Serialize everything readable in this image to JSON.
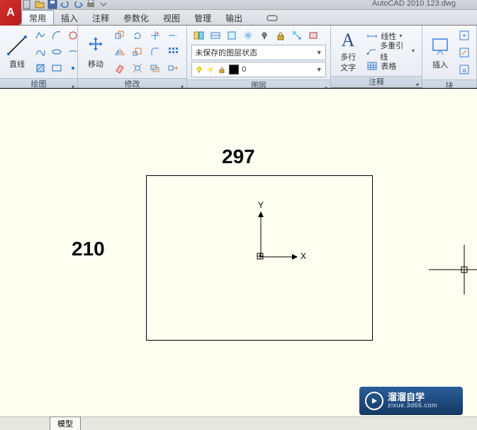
{
  "app": {
    "titlebar": "AutoCAD 2010    123.dwg",
    "logo_letter": "A"
  },
  "menu": {
    "tabs": [
      "常用",
      "插入",
      "注释",
      "参数化",
      "视图",
      "管理",
      "输出"
    ],
    "active_index": 0
  },
  "ribbon": {
    "draw": {
      "title": "绘图",
      "line_label": "直线"
    },
    "modify": {
      "title": "修改",
      "move_label": "移动"
    },
    "layers": {
      "title": "图层",
      "state_combo": "未保存的图层状态",
      "current_layer": "0"
    },
    "annotation": {
      "title": "注释",
      "mtext_label_l1": "多行",
      "mtext_label_l2": "文字",
      "linetype_label": "线性",
      "mleader_label": "多重引线",
      "table_label": "表格"
    },
    "block": {
      "title": "块",
      "insert_label": "插入"
    }
  },
  "drawing": {
    "width_label": "297",
    "height_label": "210",
    "y_axis": "Y",
    "x_axis": "X"
  },
  "watermark": {
    "brand": "溜溜自学",
    "url": "zixue.3d66.com"
  },
  "tabs": {
    "model": "模型"
  }
}
